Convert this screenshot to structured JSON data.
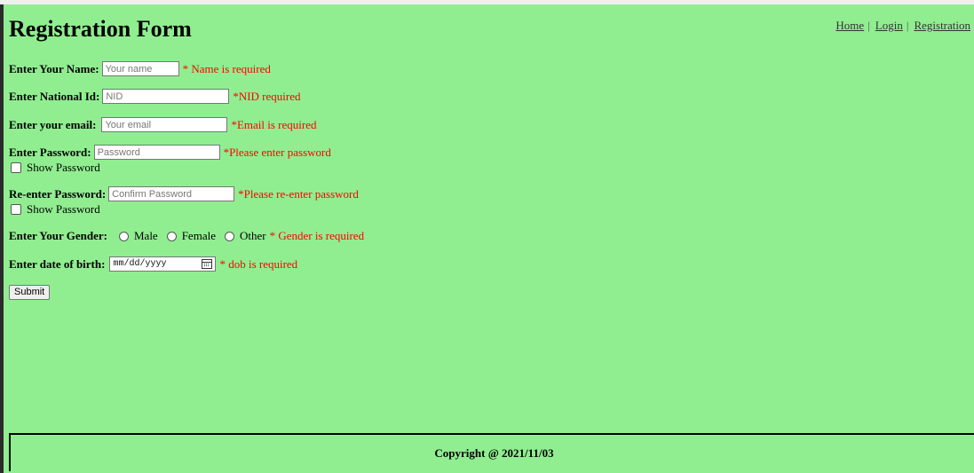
{
  "nav": {
    "home": "Home",
    "login": "Login",
    "registration": "Registration",
    "separator": "|"
  },
  "title": "Registration Form",
  "form": {
    "name": {
      "label": "Enter Your Name:",
      "placeholder": "Your name",
      "error": "* Name is required"
    },
    "nid": {
      "label": "Enter National Id:",
      "placeholder": "NID",
      "error": "*NID required"
    },
    "email": {
      "label": "Enter your email:",
      "placeholder": "Your email",
      "error": "*Email is required"
    },
    "password": {
      "label": "Enter Password:",
      "placeholder": "Password",
      "error": "*Please enter password",
      "show_label": "Show Password"
    },
    "confirm": {
      "label": "Re-enter Password:",
      "placeholder": "Confirm Password",
      "error": "*Please re-enter password",
      "show_label": "Show Password"
    },
    "gender": {
      "label": "Enter Your Gender:",
      "options": [
        "Male",
        "Female",
        "Other"
      ],
      "error": "* Gender is required"
    },
    "dob": {
      "label": "Enter date of birth:",
      "value": "mm/dd/yyyy",
      "error": "* dob is required"
    },
    "submit_label": "Submit"
  },
  "footer": {
    "text": "Copyright @ 2021/11/03"
  },
  "colors": {
    "background": "#90EE90",
    "error": "#ff0000"
  }
}
